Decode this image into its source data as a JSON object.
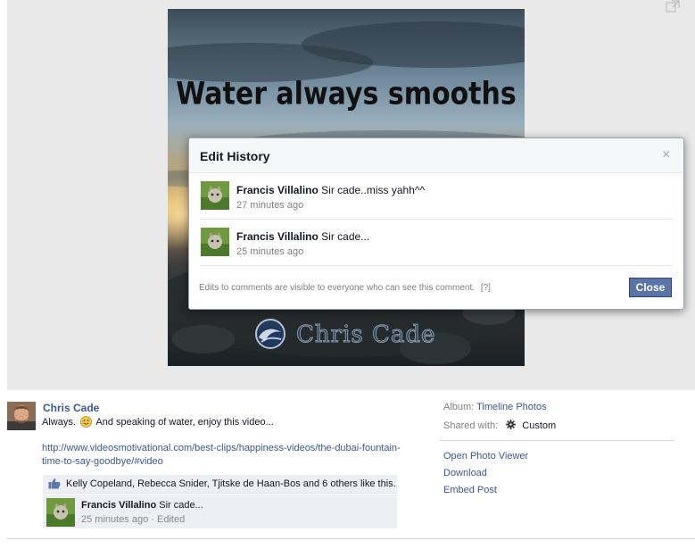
{
  "photo": {
    "headline": "Water always smooths",
    "brand": "Chris Cade",
    "expand_icon": "expand-icon"
  },
  "edit_history": {
    "title": "Edit History",
    "close_x": "×",
    "items": [
      {
        "author": "Francis Villalino",
        "text": "Sir cade..miss yahh^^",
        "time": "27 minutes ago"
      },
      {
        "author": "Francis Villalino",
        "text": "Sir cade...",
        "time": "25 minutes ago"
      }
    ],
    "note": "Edits to comments are visible to everyone who can see this comment.",
    "help": "[?]",
    "close_label": "Close"
  },
  "post": {
    "author": "Chris Cade",
    "text_before": "Always.",
    "text_after": "And speaking of water, enjoy this video...",
    "link": "http://www.videosmotivational.com/best-clips/happiness-videos/the-dubai-fountain-time-to-say-goodbye/#video",
    "likes": "Kelly Copeland, Rebecca Snider, Tjitske de Haan-Bos and 6 others like this.",
    "comment": {
      "author": "Francis Villalino",
      "text": "Sir cade...",
      "time": "25 minutes ago",
      "separator": "·",
      "edited": "Edited"
    }
  },
  "sidebar": {
    "album_label": "Album:",
    "album_value": "Timeline Photos",
    "shared_label": "Shared with:",
    "shared_value": "Custom",
    "actions": [
      "Open Photo Viewer",
      "Download",
      "Embed Post"
    ]
  },
  "colors": {
    "link": "#3b5998",
    "button": "#5b74a8",
    "stage": "#e9e9e9"
  }
}
